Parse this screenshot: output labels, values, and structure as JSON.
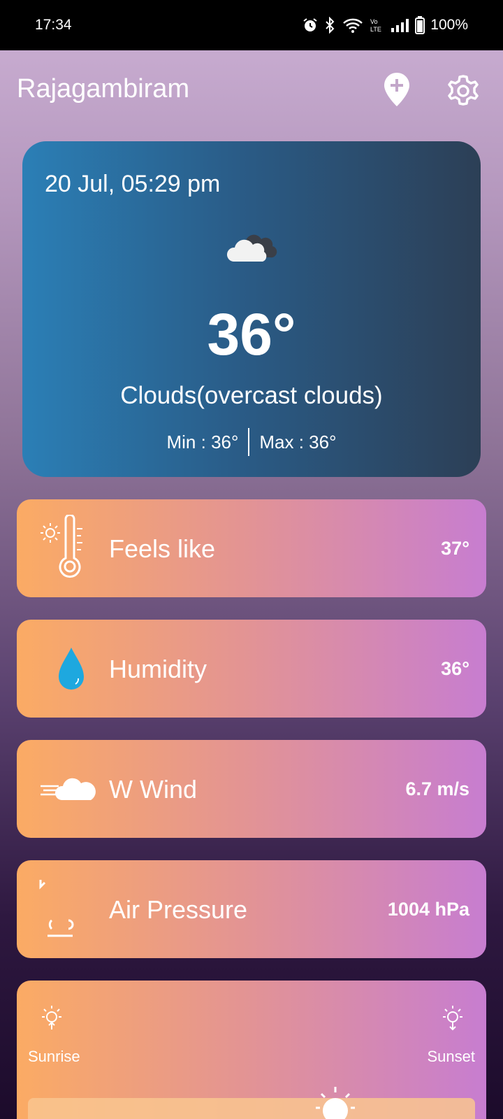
{
  "status_bar": {
    "time": "17:34",
    "battery": "100%"
  },
  "header": {
    "city": "Rajagambiram"
  },
  "current": {
    "datetime": "20 Jul, 05:29 pm",
    "icon": "cloud-icon",
    "temperature": "36°",
    "description": "Clouds(overcast clouds)",
    "min": "Min : 36°",
    "max": "Max : 36°"
  },
  "stats": [
    {
      "label": "Feels like",
      "value": "37°",
      "icon": "thermometer-icon"
    },
    {
      "label": "Humidity",
      "value": "36°",
      "icon": "water-drop-icon"
    },
    {
      "label": "W Wind",
      "value": "6.7 m/s",
      "icon": "wind-icon"
    },
    {
      "label": "Air Pressure",
      "value": "1004 hPa",
      "icon": "pressure-icon"
    }
  ],
  "sun": {
    "sunrise_label": "Sunrise",
    "sunset_label": "Sunset"
  },
  "colors": {
    "card_gradient_start": "#fbab64",
    "card_gradient_end": "#c77dd0",
    "main_card_start": "#2b7fb6",
    "main_card_end": "#2c3f56"
  }
}
